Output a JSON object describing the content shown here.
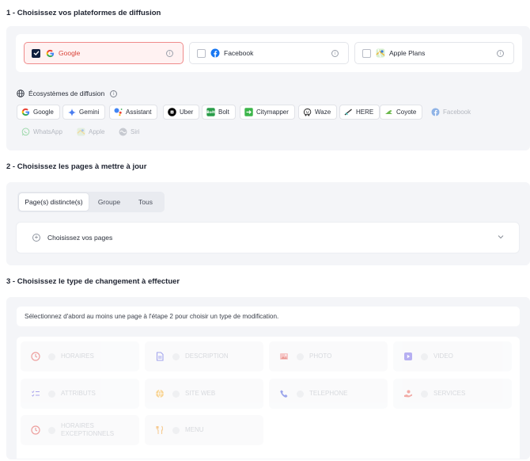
{
  "section1": {
    "title": "1 - Choisissez vos plateformes de diffusion",
    "platforms": [
      {
        "label": "Google",
        "checked": true,
        "icon": "google-icon"
      },
      {
        "label": "Facebook",
        "checked": false,
        "icon": "facebook-icon"
      },
      {
        "label": "Apple Plans",
        "checked": false,
        "icon": "apple-plans-icon"
      }
    ],
    "ecosystems_title": "Écosystèmes de diffusion",
    "ecosystems": [
      {
        "label": "Google",
        "enabled": true
      },
      {
        "label": "Gemini",
        "enabled": true
      },
      {
        "label": "Assistant",
        "enabled": true
      },
      {
        "label": "Uber",
        "enabled": true
      },
      {
        "label": "Bolt",
        "enabled": true
      },
      {
        "label": "Citymapper",
        "enabled": true
      },
      {
        "label": "Waze",
        "enabled": true
      },
      {
        "label": "HERE",
        "enabled": true
      },
      {
        "label": "Coyote",
        "enabled": true
      },
      {
        "label": "Facebook",
        "enabled": false
      },
      {
        "label": "WhatsApp",
        "enabled": false
      },
      {
        "label": "Apple",
        "enabled": false
      },
      {
        "label": "Siri",
        "enabled": false
      }
    ]
  },
  "section2": {
    "title": "2 - Choisissez les pages à mettre à jour",
    "tabs": [
      "Page(s) distincte(s)",
      "Groupe",
      "Tous"
    ],
    "active_tab": "Page(s) distincte(s)",
    "pages_placeholder": "Choisissez vos pages"
  },
  "section3": {
    "title": "3 - Choisissez le type de changement à effectuer",
    "notice": "Sélectionnez d'abord au moins une page à l'étape 2 pour choisir un type de modification.",
    "types": [
      {
        "label": "HORAIRES",
        "icon": "clock-icon"
      },
      {
        "label": "DESCRIPTION",
        "icon": "document-icon"
      },
      {
        "label": "PHOTO",
        "icon": "photo-icon"
      },
      {
        "label": "VIDEO",
        "icon": "video-icon"
      },
      {
        "label": "ATTRIBUTS",
        "icon": "list-icon"
      },
      {
        "label": "SITE WEB",
        "icon": "globe-icon"
      },
      {
        "label": "TELEPHONE",
        "icon": "phone-icon"
      },
      {
        "label": "SERVICES",
        "icon": "services-icon"
      },
      {
        "label": "HORAIRES EXCEPTIONNELS",
        "icon": "clock-icon"
      },
      {
        "label": "MENU",
        "icon": "menu-icon"
      }
    ]
  },
  "colors": {
    "selected_border": "#ef8b8b",
    "selected_text": "#d9443a",
    "checkbox_on": "#0f1f3d",
    "panel_bg": "#f4f5f8"
  }
}
